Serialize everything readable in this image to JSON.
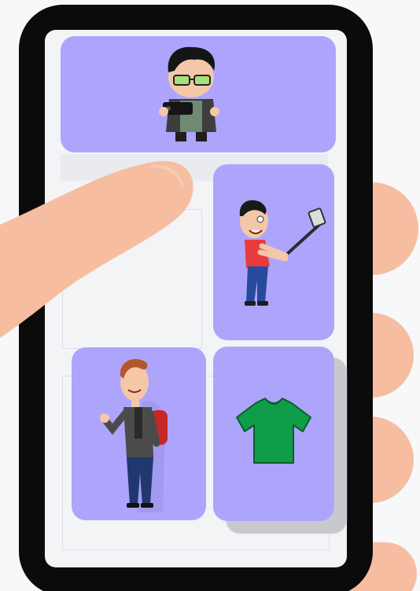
{
  "scene": {
    "cards": [
      {
        "name": "card-gamer-character",
        "icon": "gamer-with-controller-icon"
      },
      {
        "name": "card-selfie-character",
        "icon": "selfie-stick-character-icon"
      },
      {
        "name": "card-backpacker-character",
        "icon": "backpack-character-icon"
      },
      {
        "name": "card-tshirt",
        "icon": "green-tshirt-icon"
      }
    ],
    "colors": {
      "card_bg": "#ada5fb",
      "skin": "#f7bda0",
      "phone": "#0b0b0b",
      "tshirt": "#0f9d49"
    }
  }
}
